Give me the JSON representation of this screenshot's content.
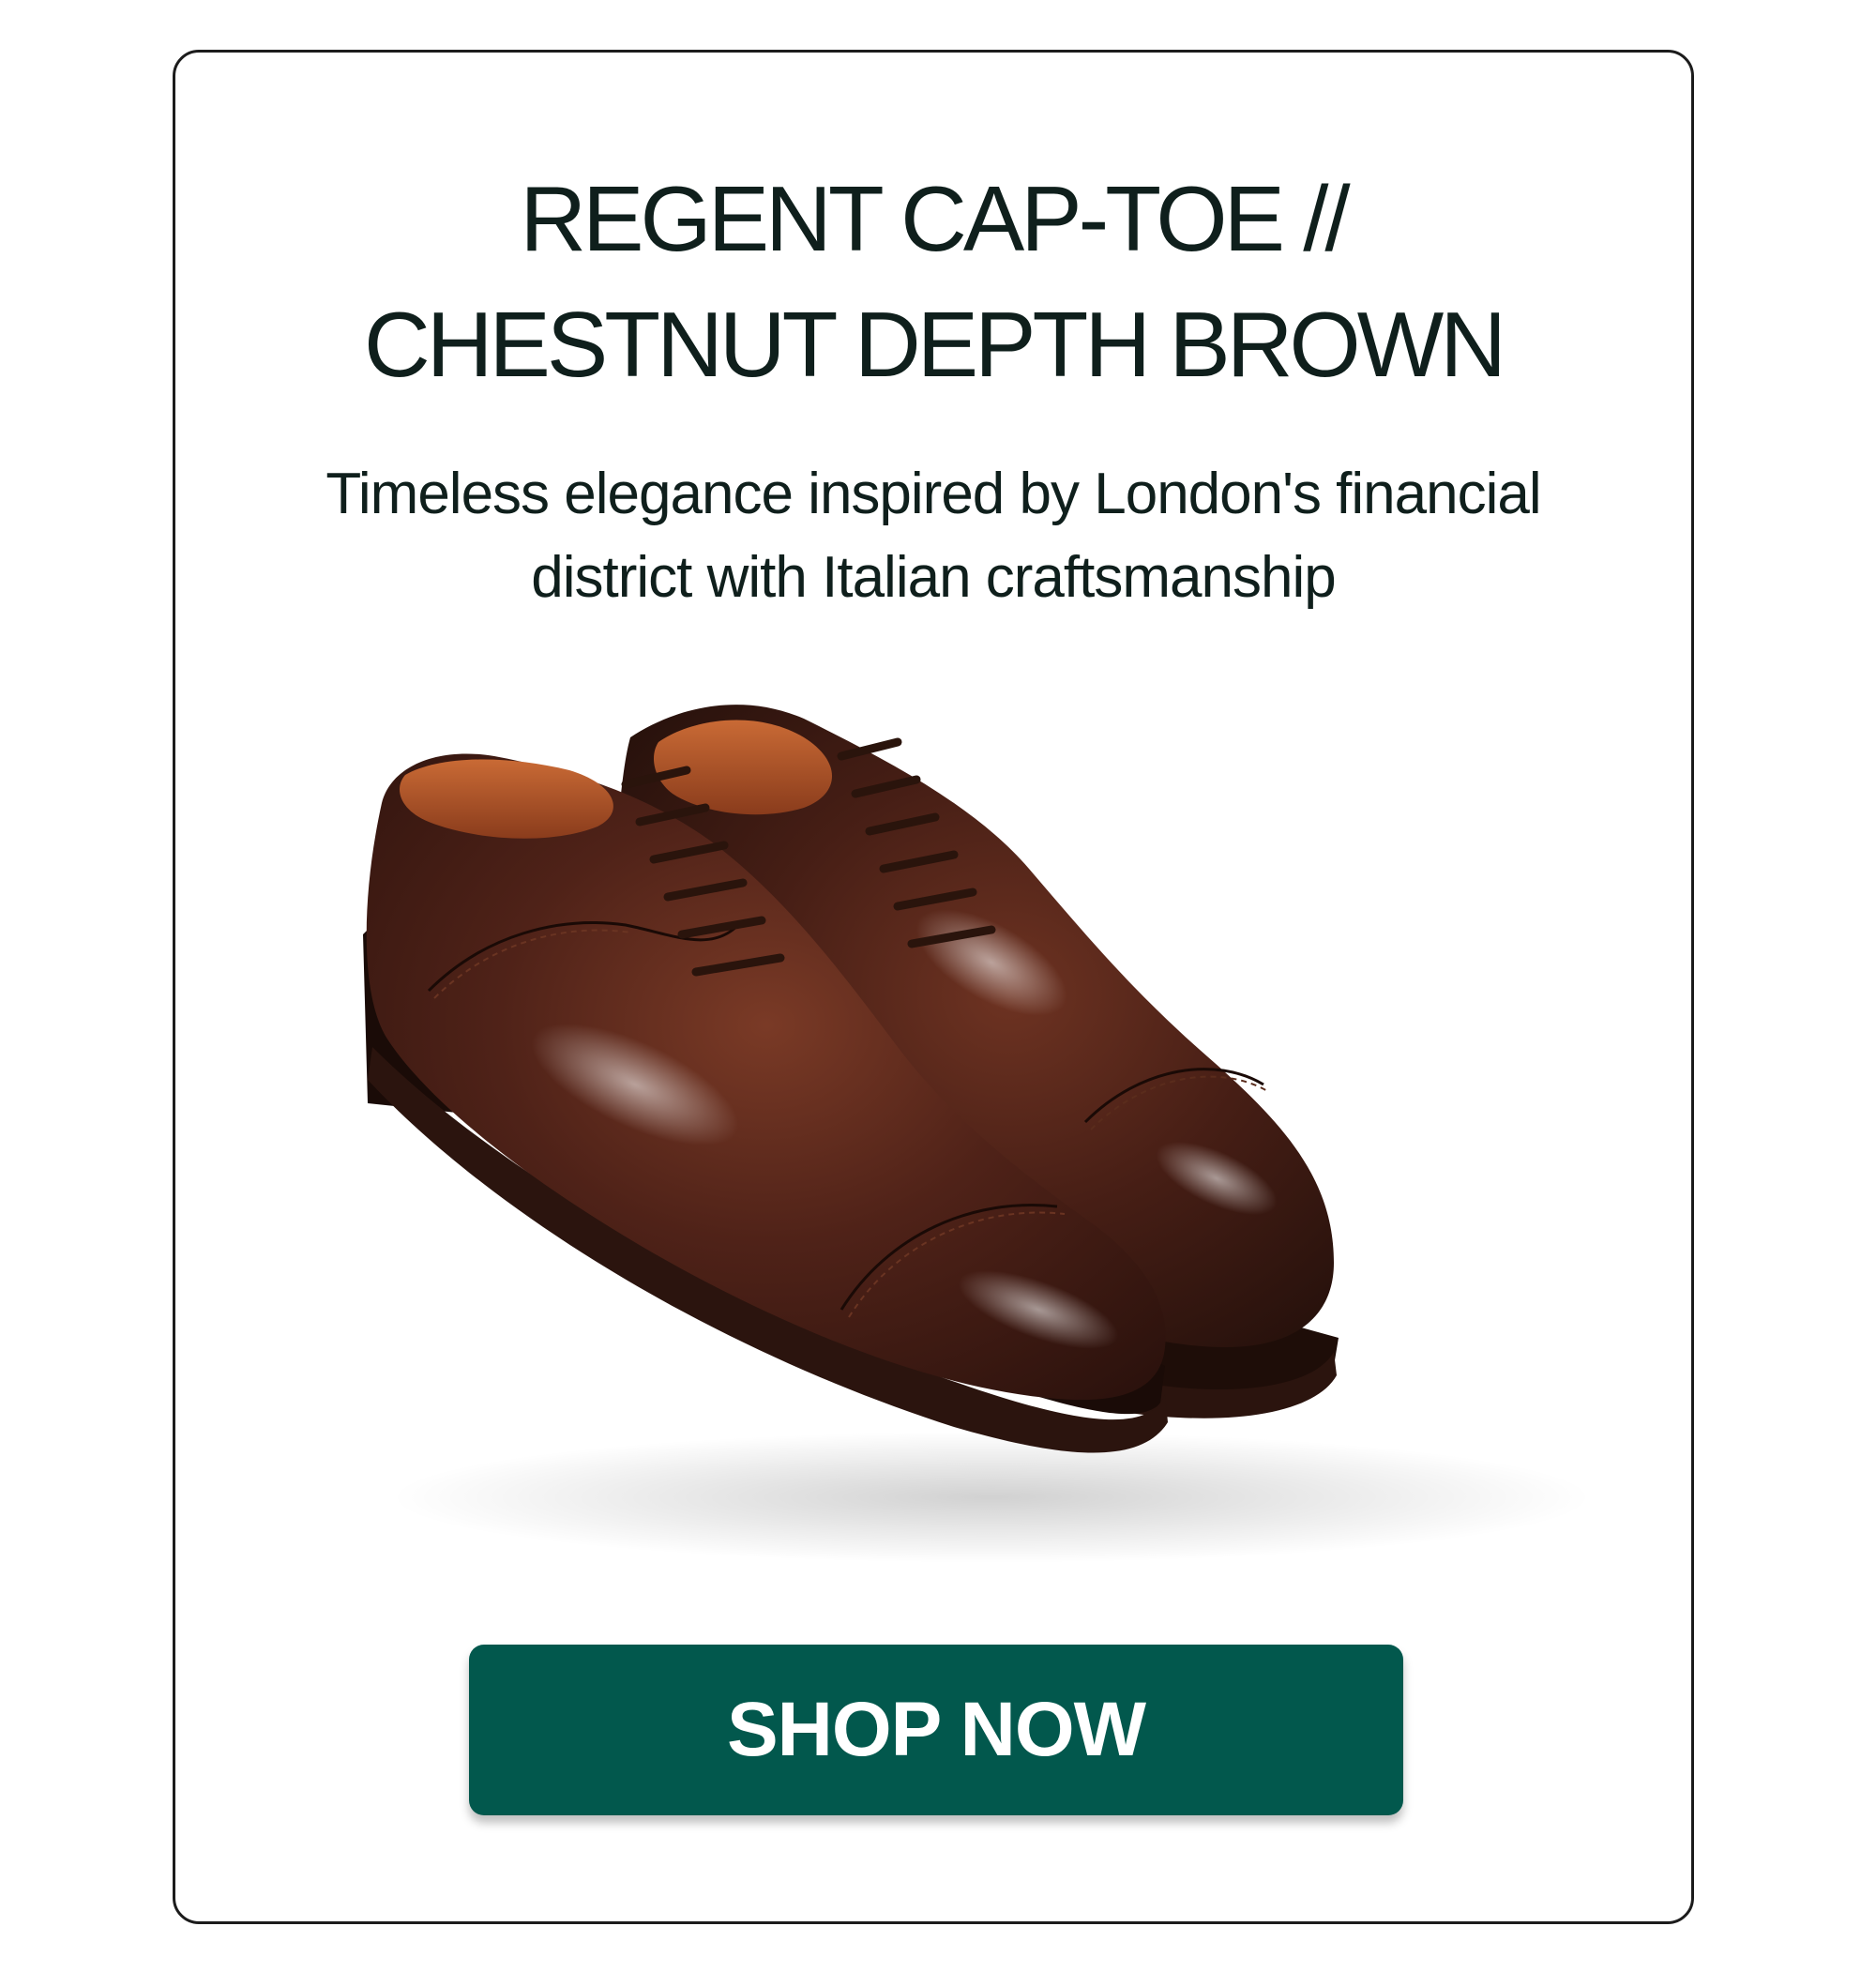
{
  "product": {
    "title_line1": "REGENT CAP-TOE //",
    "title_line2": "CHESTNUT DEPTH BROWN",
    "description_line1": "Timeless elegance inspired by London's financial",
    "description_line2": "district with Italian craftsmanship",
    "image_icon": "oxford-cap-toe-shoes-image"
  },
  "cta": {
    "label": "SHOP NOW"
  },
  "colors": {
    "button_bg": "#02584d",
    "text": "#0f1f1c",
    "card_border": "#1c1c1c",
    "leather": "#3e1a12"
  }
}
